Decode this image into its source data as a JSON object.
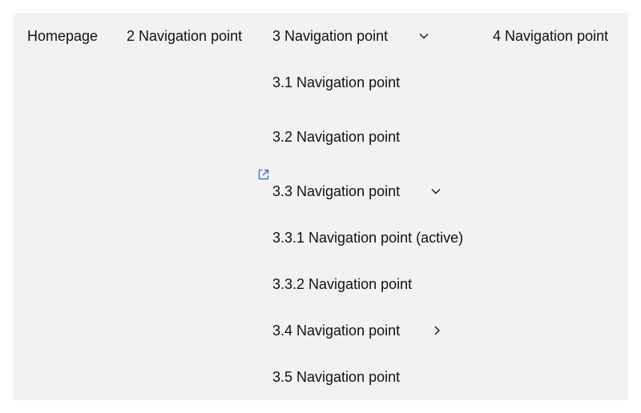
{
  "nav": {
    "top": [
      {
        "label": "Homepage"
      },
      {
        "label": "2 Navigation point"
      },
      {
        "label": "3 Navigation point"
      },
      {
        "label": "4 Navigation point"
      }
    ],
    "sub": [
      {
        "label": "3.1 Navigation point"
      },
      {
        "label": "3.2 Navigation point"
      },
      {
        "label": "3.3 Navigation point"
      },
      {
        "label": "3.3.1 Navigation point (active)"
      },
      {
        "label": "3.3.2 Navigation point"
      },
      {
        "label": "3.4 Navigation point"
      },
      {
        "label": "3.5 Navigation point"
      }
    ]
  },
  "icons": {
    "top3": "chevron-down-icon",
    "sub33": "chevron-down-icon",
    "sub34": "chevron-right-icon",
    "external": "external-link-icon"
  },
  "colors": {
    "panel": "#f2f2f2",
    "text": "#111111",
    "link_icon": "#2f6fd8"
  }
}
